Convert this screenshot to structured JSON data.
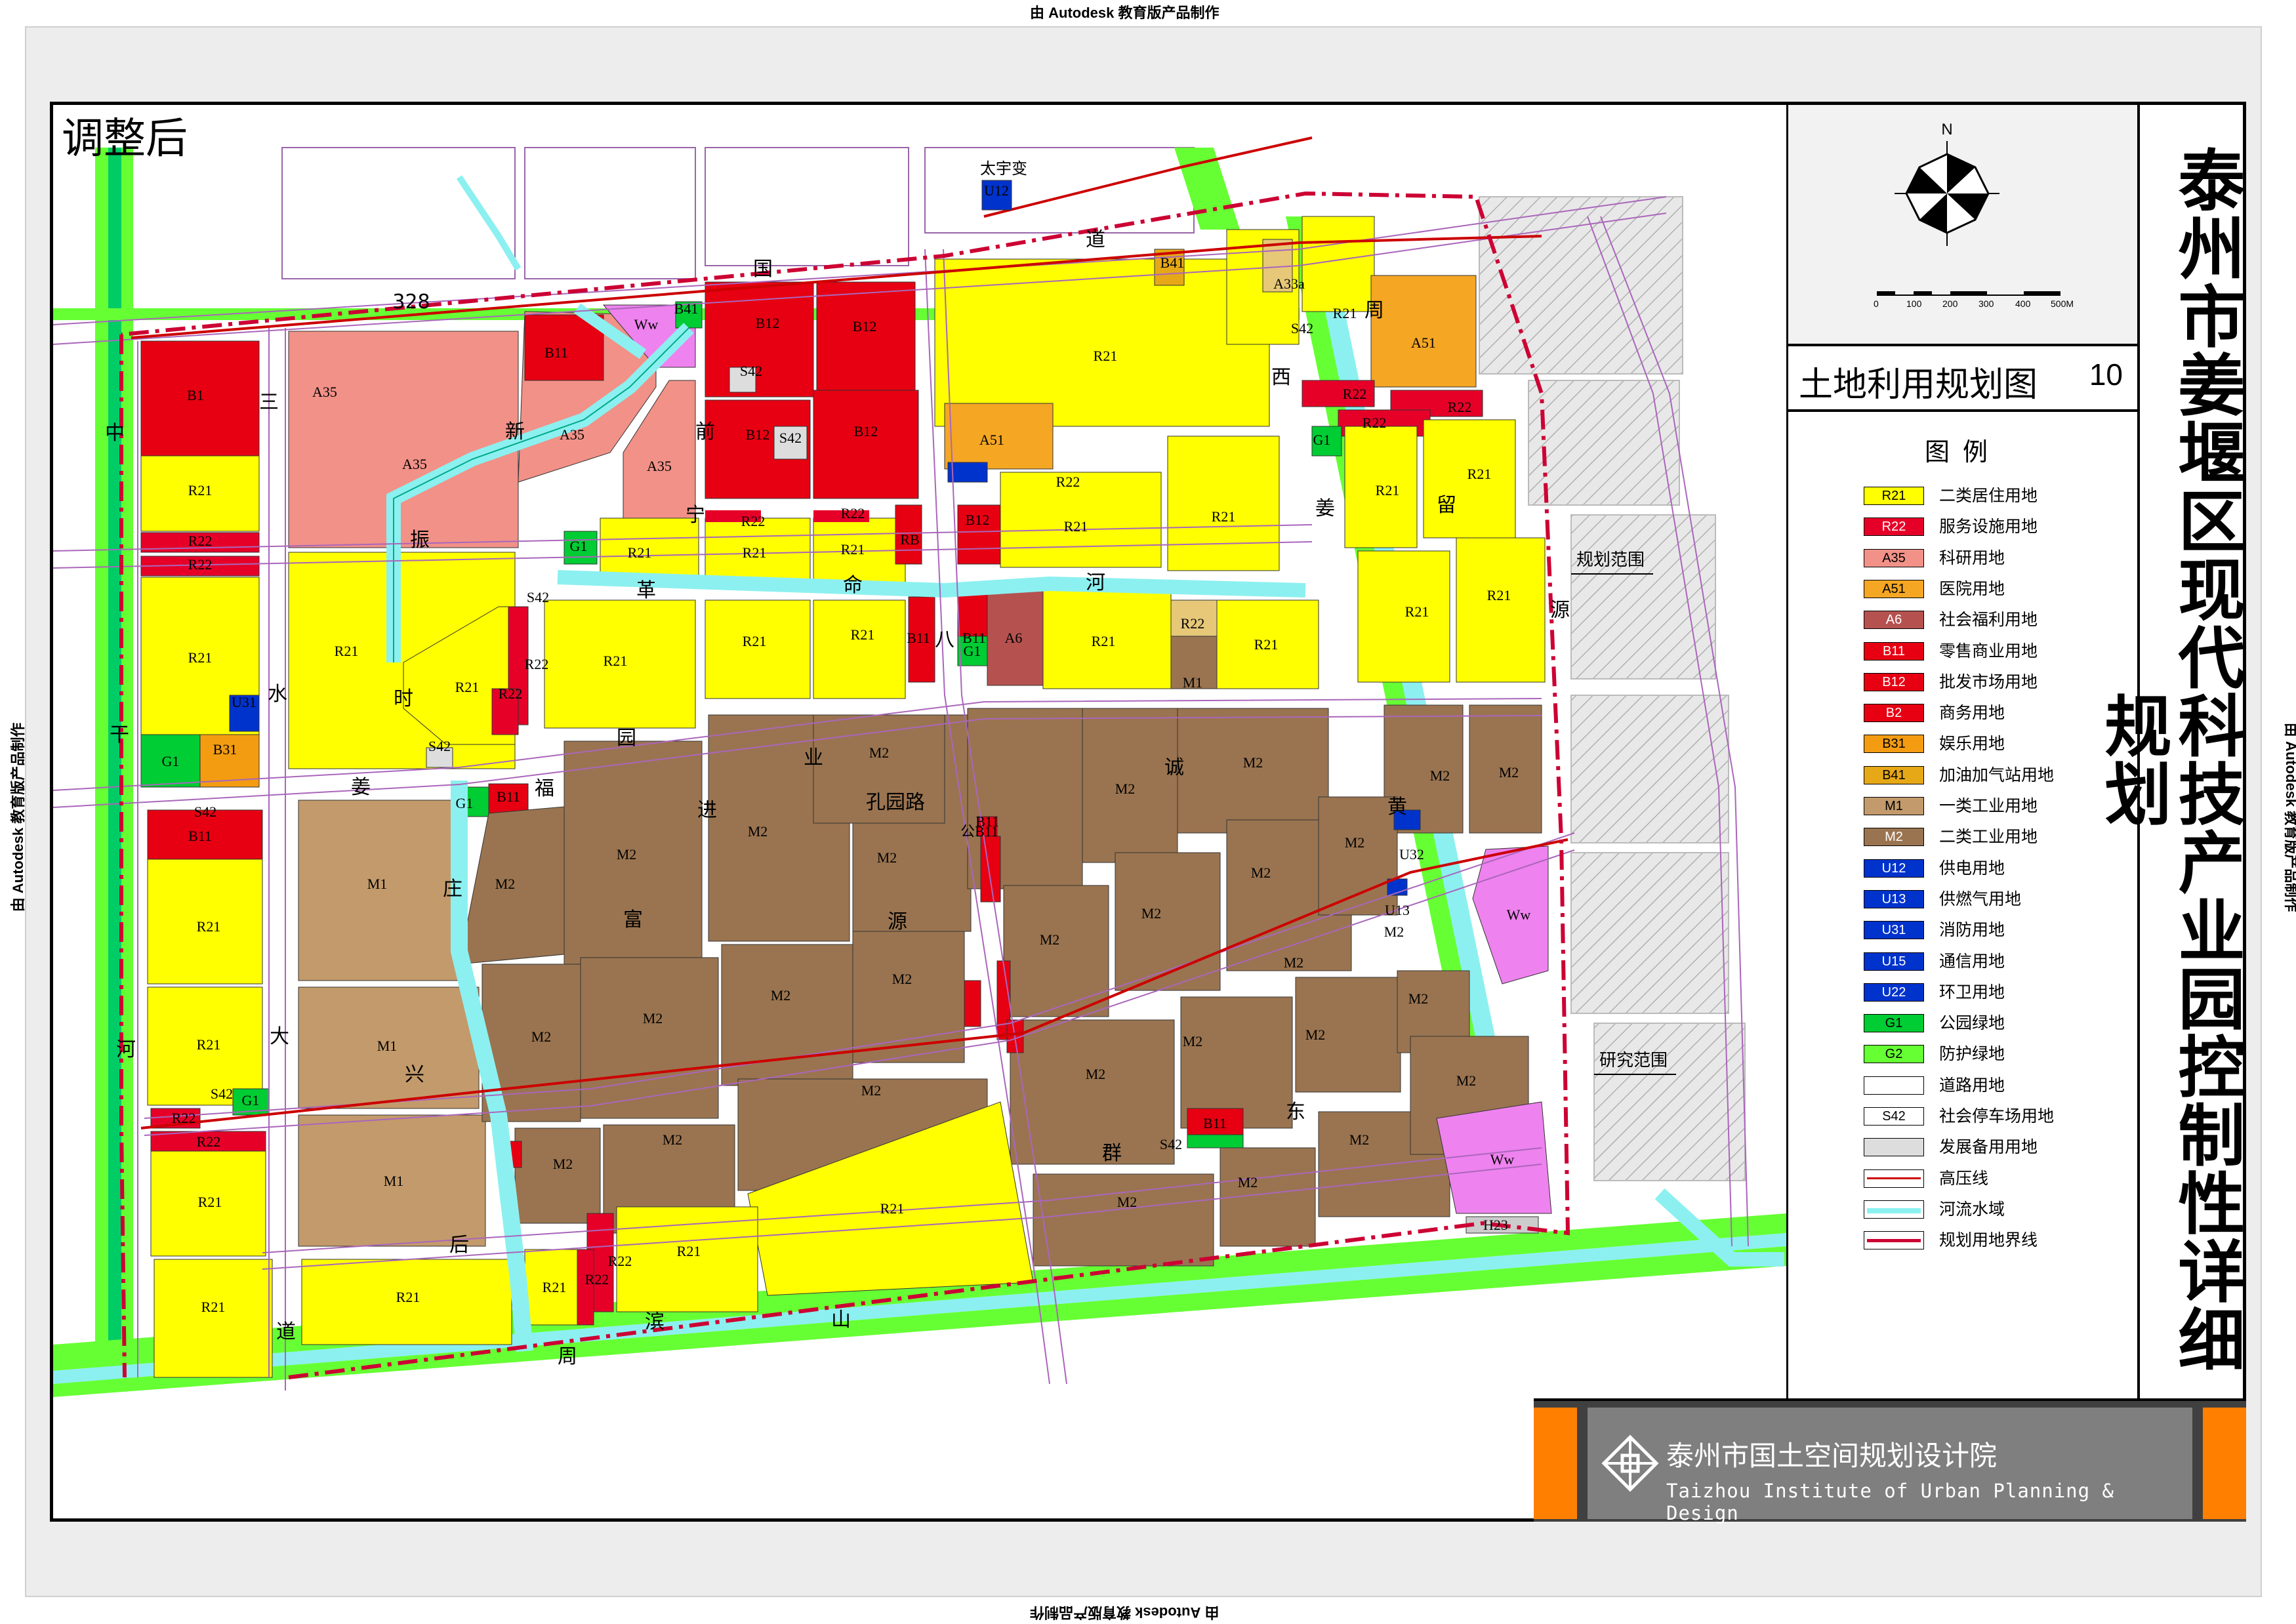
{
  "watermarks": {
    "top": "由 Autodesk 教育版产品制作",
    "bottom": "由 Autodesk 教育版产品制作",
    "left": "由 Autodesk 教育版产品制作",
    "right": "由 Autodesk 教育版产品制作"
  },
  "corner_label": "调整后",
  "title": "泰州市姜堰区现代科技产业园控制性详细规划",
  "panel_title": "土地利用规划图",
  "sheet_number": "10",
  "compass": {
    "north": "N",
    "scale_ticks": [
      "0",
      "100",
      "200",
      "300",
      "400",
      "500M"
    ]
  },
  "legend": {
    "heading": "图例",
    "items": [
      {
        "code": "R21",
        "label": "二类居住用地",
        "color": "#ffff00"
      },
      {
        "code": "R22",
        "label": "服务设施用地",
        "color": "#e60028"
      },
      {
        "code": "A35",
        "label": "科研用地",
        "color": "#f19187"
      },
      {
        "code": "A51",
        "label": "医院用地",
        "color": "#f5a623"
      },
      {
        "code": "A6",
        "label": "社会福利用地",
        "color": "#b5524f"
      },
      {
        "code": "B11",
        "label": "零售商业用地",
        "color": "#e60012"
      },
      {
        "code": "B12",
        "label": "批发市场用地",
        "color": "#e60012"
      },
      {
        "code": "B2",
        "label": "商务用地",
        "color": "#e60012"
      },
      {
        "code": "B31",
        "label": "娱乐用地",
        "color": "#f39c12"
      },
      {
        "code": "B41",
        "label": "加油加气站用地",
        "color": "#e6a817"
      },
      {
        "code": "M1",
        "label": "一类工业用地",
        "color": "#c39a6b"
      },
      {
        "code": "M2",
        "label": "二类工业用地",
        "color": "#9a7450"
      },
      {
        "code": "U12",
        "label": "供电用地",
        "color": "#0033cc"
      },
      {
        "code": "U13",
        "label": "供燃气用地",
        "color": "#0033cc"
      },
      {
        "code": "U31",
        "label": "消防用地",
        "color": "#0033cc"
      },
      {
        "code": "U15",
        "label": "通信用地",
        "color": "#0033cc"
      },
      {
        "code": "U22",
        "label": "环卫用地",
        "color": "#0033cc"
      },
      {
        "code": "G1",
        "label": "公园绿地",
        "color": "#00cc33"
      },
      {
        "code": "G2",
        "label": "防护绿地",
        "color": "#66ff33"
      },
      {
        "code": "",
        "label": "道路用地",
        "color": "#ffffff"
      },
      {
        "code": "S42",
        "label": "社会停车场用地",
        "color": "#ffffff"
      },
      {
        "code": "",
        "label": "发展备用用地",
        "color": "#dddddd"
      },
      {
        "code": "",
        "label": "高压线",
        "color": "#cc0000"
      },
      {
        "code": "",
        "label": "河流水域",
        "color": "#8cf0f0"
      },
      {
        "code": "",
        "label": "规划用地界线",
        "color": "#cc0033"
      }
    ]
  },
  "institute": {
    "name_cn": "泰州市国土空间规划设计院",
    "name_en": "Taizhou Institute of Urban Planning & Design"
  },
  "map": {
    "parcel_labels": {
      "r21": "R21",
      "r22": "R22",
      "a35": "A35",
      "a51": "A51",
      "a6": "A6",
      "b1": "B1",
      "b11": "B11",
      "b12": "B12",
      "b31": "B31",
      "b41": "B41",
      "rb": "RB",
      "m1": "M1",
      "m2": "M2",
      "g1": "G1",
      "ww": "Ww",
      "s42": "S42",
      "u12": "U12",
      "u13": "U13",
      "u31": "U31",
      "u32": "U32",
      "u22": "U22",
      "h23": "H23",
      "a33a": "A33a",
      "gongb11": "公B11"
    },
    "station": "太宇变",
    "range_planning": "规划范围",
    "range_research": "研究范围",
    "road_chars": {
      "road328": "328",
      "c_guo": "国",
      "c_dao": "道",
      "c_zhong": "中",
      "c_gan": "干",
      "c_he": "河",
      "c_dao2": "道",
      "c_san": "三",
      "c_shui": "水",
      "c_da": "大",
      "c_xin": "新",
      "c_zhen": "振",
      "c_jiang": "姜",
      "c_xing": "兴",
      "c_lu": "路",
      "c_qian": "前",
      "c_ning": "宁",
      "c_geming": "革",
      "c_ming": "命",
      "c_he2": "河",
      "c_shi": "时",
      "c_yuan": "园",
      "c_ye": "业",
      "c_kongyuan": "孔园路",
      "c_fu": "福",
      "c_zhuang": "庄",
      "c_jin": "进",
      "c_gu": "富",
      "c_yuan2": "源",
      "c_cheng": "诚",
      "c_huang": "黄",
      "c_dong": "东",
      "c_qun": "群",
      "c_zhou": "周",
      "c_bin": "滨",
      "c_shan": "山",
      "c_hou": "后",
      "c_xi": "西",
      "c_jiang2": "姜",
      "c_zhou2": "周",
      "c_liu": "留",
      "c_yuan3": "源",
      "c_ba": "八"
    }
  }
}
